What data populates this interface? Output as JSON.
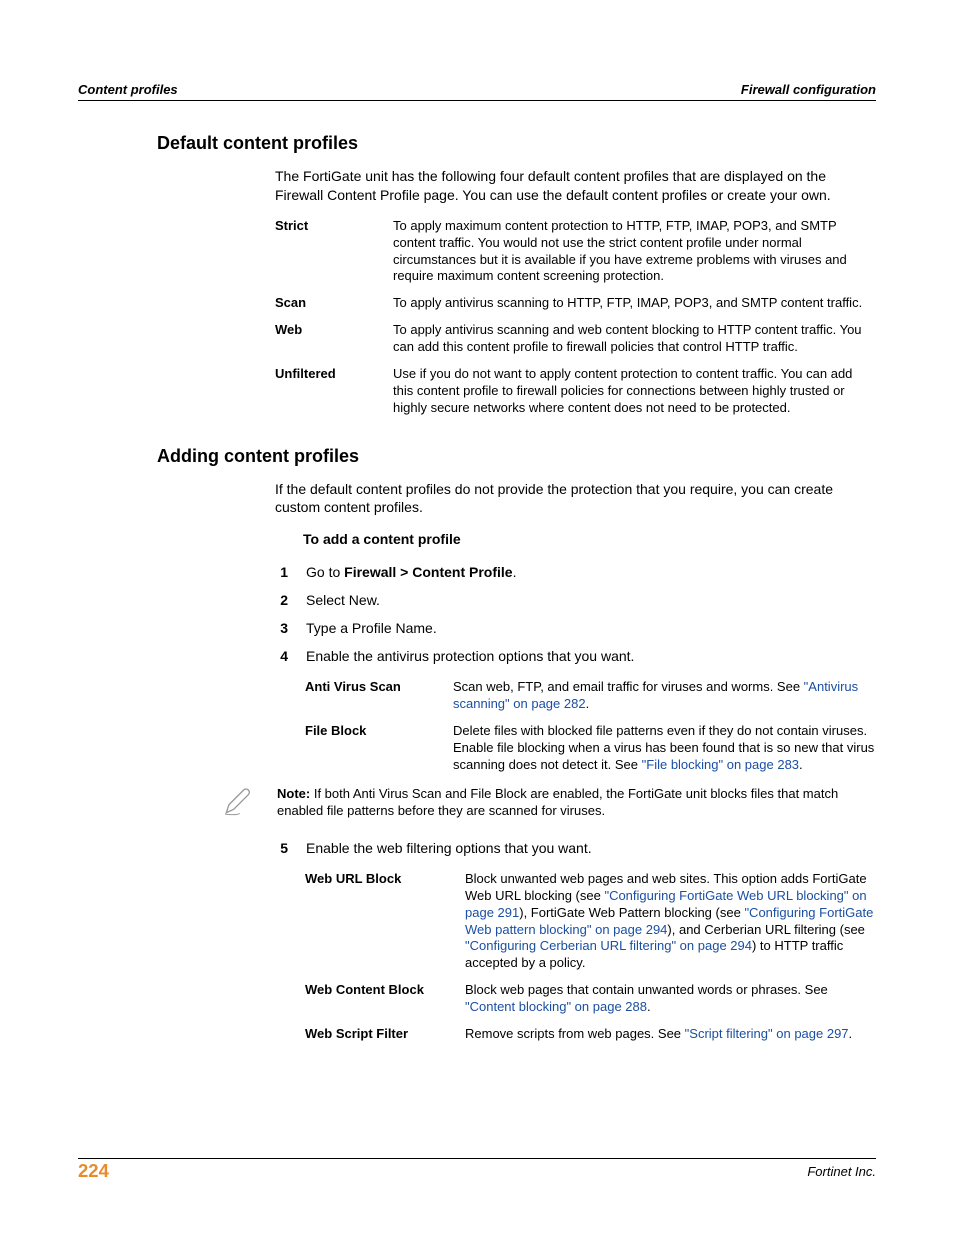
{
  "header": {
    "left": "Content profiles",
    "right": "Firewall configuration"
  },
  "section1": {
    "title": "Default content profiles",
    "intro": "The FortiGate unit has the following four default content profiles that are displayed on the Firewall Content Profile page. You can use the default content profiles or create your own.",
    "items": [
      {
        "term": "Strict",
        "desc": "To apply maximum content protection to HTTP, FTP, IMAP, POP3, and SMTP content traffic. You would not use the strict content profile under normal circumstances but it is available if you have extreme problems with viruses and require maximum content screening protection."
      },
      {
        "term": "Scan",
        "desc": "To apply antivirus scanning to HTTP, FTP, IMAP, POP3, and SMTP content traffic."
      },
      {
        "term": "Web",
        "desc": "To apply antivirus scanning and web content blocking to HTTP content traffic. You can add this content profile to firewall policies that control HTTP traffic."
      },
      {
        "term": "Unfiltered",
        "desc": "Use if you do not want to apply content protection to content traffic. You can add this content profile to firewall policies for connections between highly trusted or highly secure networks where content does not need to be protected."
      }
    ]
  },
  "section2": {
    "title": "Adding content profiles",
    "intro": "If the default content profiles do not provide the protection that you require, you can create custom content profiles.",
    "subhead": "To add a content profile",
    "step1_prefix": "Go to ",
    "step1_bold": "Firewall > Content Profile",
    "step1_suffix": ".",
    "step2": "Select New.",
    "step3": "Type a Profile Name.",
    "step4": "Enable the antivirus protection options that you want.",
    "step5": "Enable the web filtering options that you want.",
    "av": [
      {
        "term": "Anti Virus Scan",
        "desc_pre": "Scan web, FTP, and email traffic for viruses and worms. See ",
        "link": "\"Antivirus scanning\" on page 282",
        "desc_post": "."
      },
      {
        "term": "File Block",
        "desc_pre": "Delete files with blocked file patterns even if they do not contain viruses. Enable file blocking when a virus has been found that is so new that virus scanning does not detect it. See ",
        "link": "\"File blocking\" on page 283",
        "desc_post": "."
      }
    ],
    "note_bold": "Note:",
    "note_text": " If both Anti Virus Scan and File Block are enabled, the FortiGate unit blocks files that match enabled file patterns before they are scanned for viruses.",
    "wf": {
      "url_block": {
        "term": "Web URL Block",
        "t1": "Block unwanted web pages and web sites. This option adds FortiGate Web URL blocking (see ",
        "l1": "\"Configuring FortiGate Web URL blocking\" on page 291",
        "t2": "), FortiGate Web Pattern blocking (see ",
        "l2": "\"Configuring FortiGate Web pattern blocking\" on page 294",
        "t3": "), and Cerberian URL filtering (see ",
        "l3": "\"Configuring Cerberian URL filtering\" on page 294",
        "t4": ") to HTTP traffic accepted by a policy."
      },
      "content_block": {
        "term": "Web Content Block",
        "t1": "Block web pages that contain unwanted words or phrases. See ",
        "l1": "\"Content blocking\" on page 288",
        "t2": "."
      },
      "script_filter": {
        "term": "Web Script Filter",
        "t1": "Remove scripts from web pages. See ",
        "l1": "\"Script filtering\" on page 297",
        "t2": "."
      }
    }
  },
  "footer": {
    "page": "224",
    "company": "Fortinet Inc."
  }
}
